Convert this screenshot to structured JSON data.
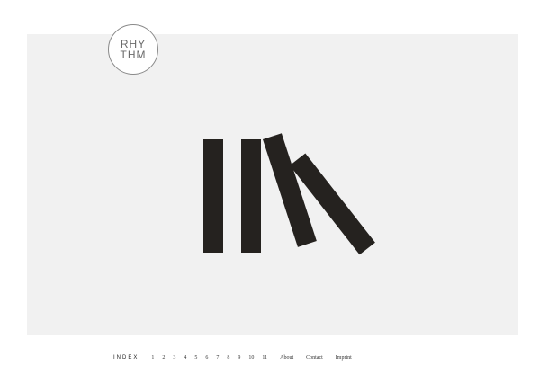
{
  "logo": {
    "line1": "RHY",
    "line2": "THM"
  },
  "nav": {
    "index_label": "INDEX",
    "pages": [
      "1",
      "2",
      "3",
      "4",
      "5",
      "6",
      "7",
      "8",
      "9",
      "10",
      "11"
    ],
    "about": "About",
    "contact": "Contact",
    "imprint": "Imprint"
  },
  "colors": {
    "background": "#ffffff",
    "stage": "#f1f1f1",
    "bars": "#25221f"
  }
}
